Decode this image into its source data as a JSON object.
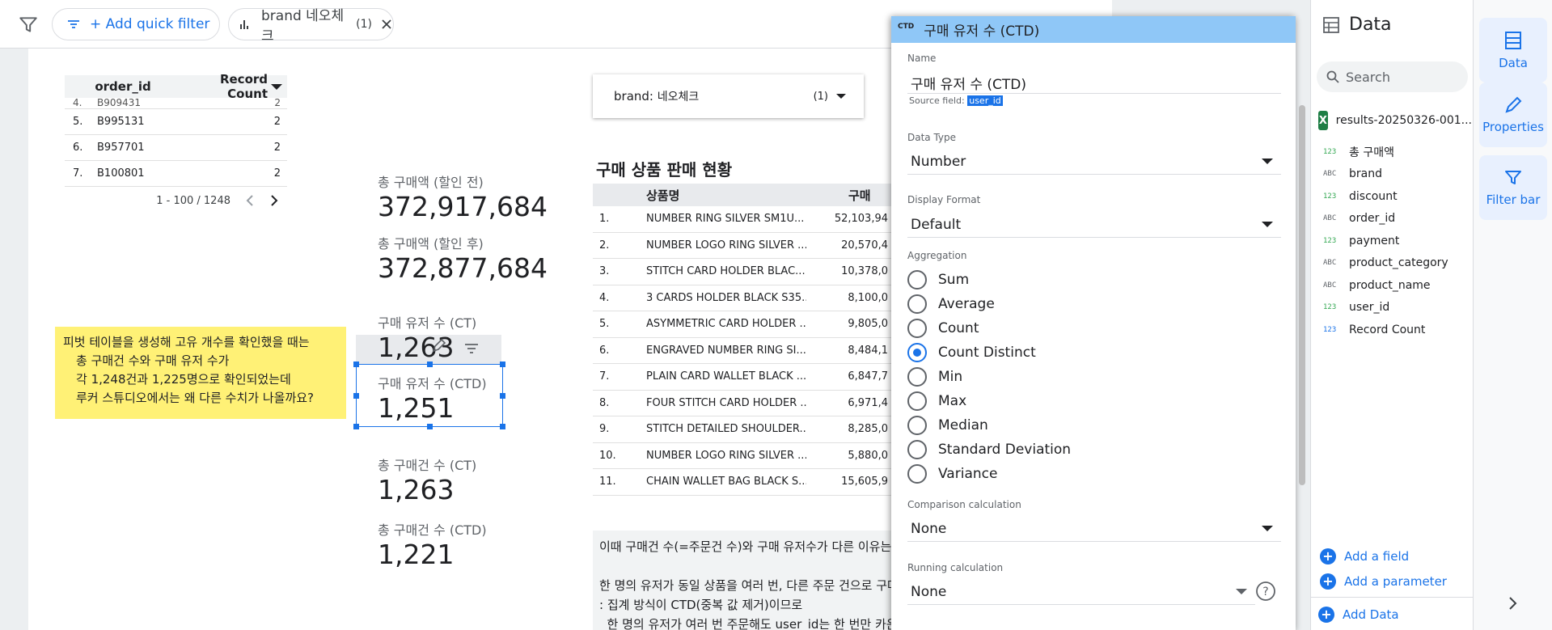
{
  "topbar": {
    "add_filter_label": "+ Add quick filter",
    "brand_chip_label": "brand 네오체크",
    "brand_chip_count": "(1)"
  },
  "order_table": {
    "headers": [
      "order_id",
      "Record Count"
    ],
    "cut_row": {
      "num": "4.",
      "id": "B909431",
      "count": "2"
    },
    "rows": [
      {
        "num": "5.",
        "id": "B995131",
        "count": "2"
      },
      {
        "num": "6.",
        "id": "B957701",
        "count": "2"
      },
      {
        "num": "7.",
        "id": "B100801",
        "count": "2"
      }
    ],
    "pager": "1 - 100 / 1248"
  },
  "scorecards": [
    {
      "label": "총 구매액 (할인 전)",
      "value": "372,917,684"
    },
    {
      "label": "총 구매액 (할인 후)",
      "value": "372,877,684"
    },
    {
      "label": "구매 유저 수 (CT)",
      "value": "1,263"
    },
    {
      "label": "구매 유저 수 (CTD)",
      "value": "1,251"
    },
    {
      "label": "총 구매건 수 (CT)",
      "value": "1,263"
    },
    {
      "label": "총 구매건 수 (CTD)",
      "value": "1,221"
    }
  ],
  "note": {
    "lines": [
      "피벗 테이블을 생성해 고유 개수를 확인했을 때는",
      "총 구매건 수와 구매 유저 수가",
      "각 1,248건과 1,225명으로 확인되었는데",
      "루커 스튜디오에서는  왜 다른 수치가 나올까요?"
    ]
  },
  "brand_control": {
    "label": "brand",
    "value": "네오체크",
    "count": "(1)"
  },
  "product_table": {
    "title": "구매 상품 판매 현황",
    "headers": [
      "상품명",
      "구매"
    ],
    "rows": [
      {
        "num": "1.",
        "name": "NUMBER RING SILVER SM1U...",
        "value": "52,103,94"
      },
      {
        "num": "2.",
        "name": "NUMBER LOGO RING SILVER ...",
        "value": "20,570,4"
      },
      {
        "num": "3.",
        "name": "STITCH CARD HOLDER BLAC...",
        "value": "10,378,0"
      },
      {
        "num": "4.",
        "name": "3 CARDS HOLDER BLACK S35...",
        "value": "8,100,0"
      },
      {
        "num": "5.",
        "name": "ASYMMETRIC CARD HOLDER ...",
        "value": "9,805,0"
      },
      {
        "num": "6.",
        "name": "ENGRAVED NUMBER RING SI...",
        "value": "8,484,1"
      },
      {
        "num": "7.",
        "name": "PLAIN CARD WALLET BLACK ...",
        "value": "6,847,7"
      },
      {
        "num": "8.",
        "name": "FOUR STITCH CARD HOLDER ...",
        "value": "6,971,4"
      },
      {
        "num": "9.",
        "name": "STITCH DETAILED SHOULDER...",
        "value": "8,285,0"
      },
      {
        "num": "10.",
        "name": "NUMBER LOGO RING SILVER ...",
        "value": "5,880,0"
      },
      {
        "num": "11.",
        "name": "CHAIN WALLET BAG BLACK S...",
        "value": "15,605,9"
      }
    ]
  },
  "bottom_text": {
    "lines": [
      "이때 구매건 수(=주문건 수)와 구매 유저수가 다른 이유는",
      "",
      "한 명의 유저가 동일 상품을 여러 번, 다른 주문 건으로 구매",
      ": 집계 방식이 CTD(중복 값 제거)이므로",
      "  한 명의 유저가 여러 번 주문해도 user_id는 한 번만 카운트"
    ]
  },
  "field_editor": {
    "header_tag": "CTD",
    "header_title": "구매 유저 수 (CTD)",
    "name_label": "Name",
    "name_value": "구매 유저 수 (CTD)",
    "source_label": "Source field:",
    "source_value": "user_id",
    "data_type_label": "Data Type",
    "data_type_value": "Number",
    "display_format_label": "Display Format",
    "display_format_value": "Default",
    "aggregation_label": "Aggregation",
    "aggregations": [
      "Sum",
      "Average",
      "Count",
      "Count Distinct",
      "Min",
      "Max",
      "Median",
      "Standard Deviation",
      "Variance"
    ],
    "selected_aggregation": "Count Distinct",
    "comparison_label": "Comparison calculation",
    "comparison_value": "None",
    "running_label": "Running calculation",
    "running_value": "None"
  },
  "data_panel": {
    "title": "Data",
    "search_placeholder": "Search",
    "source_name": "results-20250326-001...",
    "fields": [
      {
        "type": "123",
        "name": "총 구매액"
      },
      {
        "type": "ABC",
        "name": "brand"
      },
      {
        "type": "123",
        "name": "discount"
      },
      {
        "type": "ABC",
        "name": "order_id"
      },
      {
        "type": "123",
        "name": "payment"
      },
      {
        "type": "ABC",
        "name": "product_category"
      },
      {
        "type": "ABC",
        "name": "product_name"
      },
      {
        "type": "123",
        "name": "user_id"
      },
      {
        "type": "123",
        "name": "Record Count"
      }
    ],
    "add_field": "Add a field",
    "add_parameter": "Add a parameter",
    "add_data": "Add Data"
  },
  "right_rail": {
    "data": "Data",
    "properties": "Properties",
    "filter_bar": "Filter bar"
  },
  "colors": {
    "accent": "#1a73e8",
    "editor_header": "#8fc7f7",
    "note_yellow": "#fff176"
  }
}
